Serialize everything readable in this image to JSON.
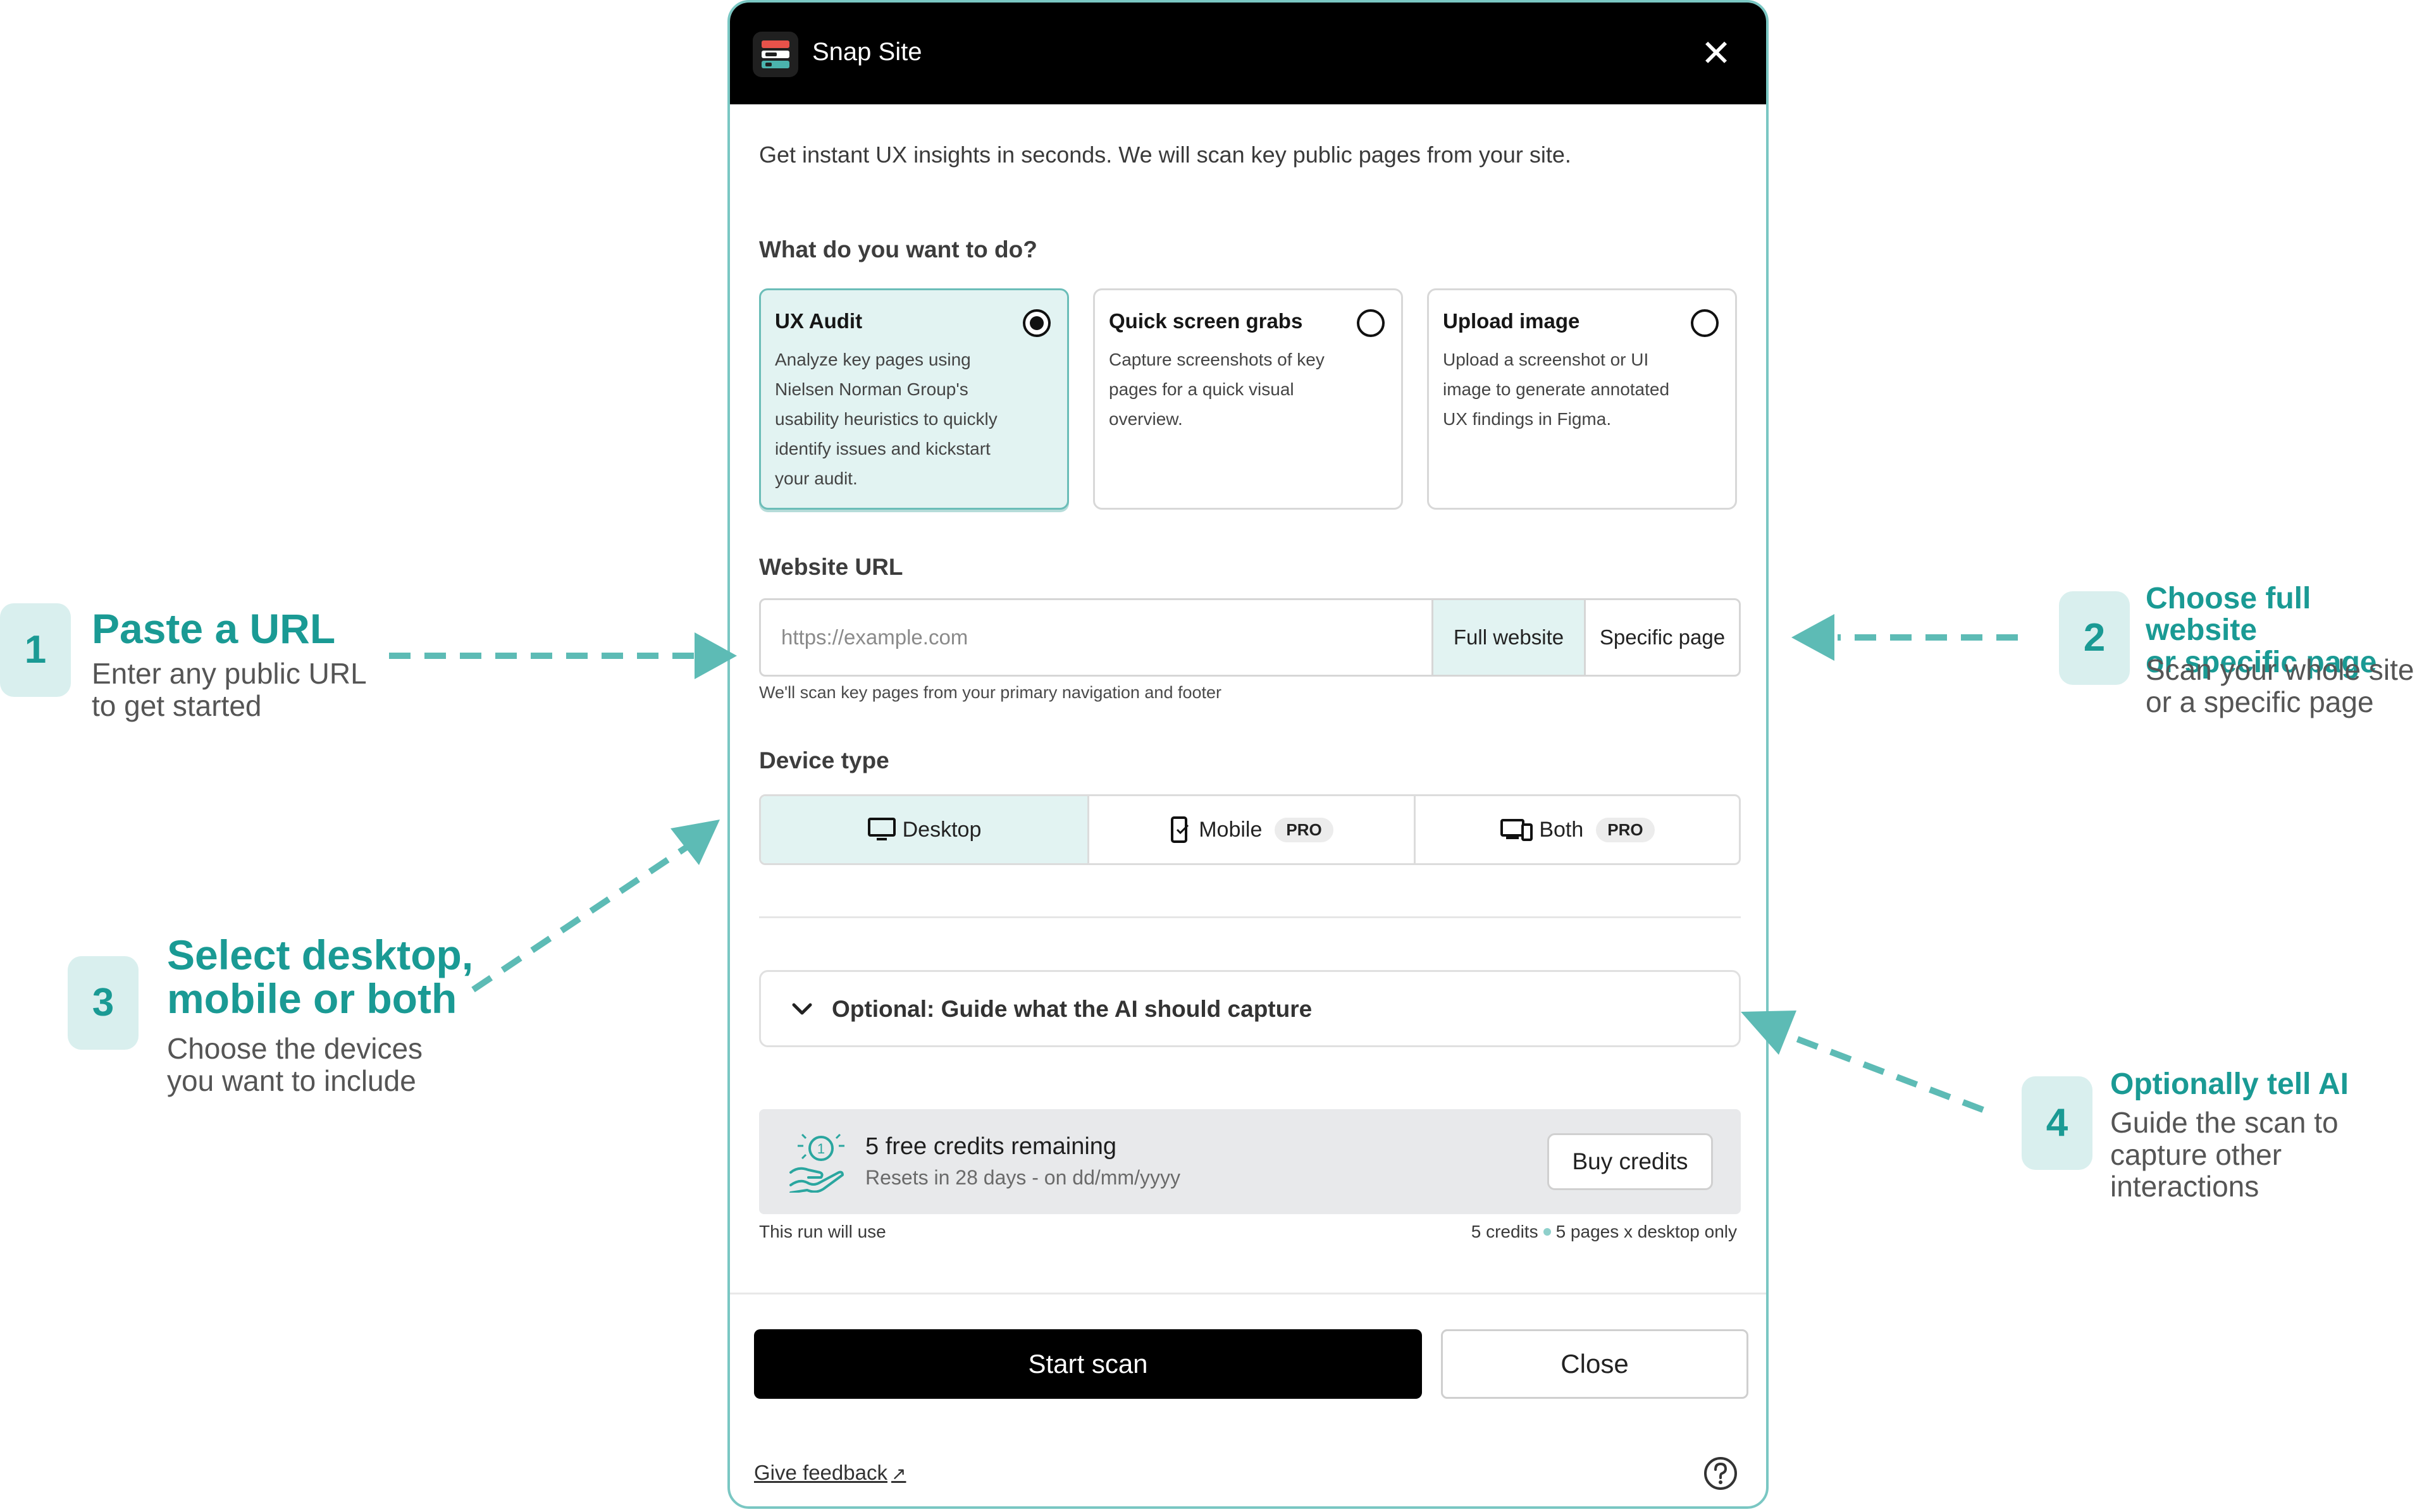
{
  "dialog": {
    "title": "Snap Site",
    "intro": "Get instant UX insights in seconds. We will scan key public pages from your site.",
    "task_label": "What do you want to do?",
    "options": [
      {
        "title": "UX Audit",
        "description": "Analyze key pages using Nielsen Norman Group's usability heuristics to quickly identify issues and kickstart your audit.",
        "selected": true
      },
      {
        "title": "Quick screen grabs",
        "description": "Capture screenshots of key pages for a quick visual overview.",
        "selected": false
      },
      {
        "title": "Upload image",
        "description": "Upload a screenshot or UI image to generate annotated UX findings in Figma.",
        "selected": false
      }
    ],
    "url_label": "Website URL",
    "url_placeholder": "https://example.com",
    "url_value": "",
    "scope_full": "Full website",
    "scope_specific": "Specific page",
    "url_hint": "We'll scan key pages from your primary navigation and footer",
    "device_label": "Device type",
    "devices": [
      {
        "label": "Desktop",
        "badge": "",
        "selected": true
      },
      {
        "label": "Mobile",
        "badge": "PRO",
        "selected": false
      },
      {
        "label": "Both",
        "badge": "PRO",
        "selected": false
      }
    ],
    "guide_label": "Optional: Guide what the AI should capture",
    "credits_title": "5 free credits remaining",
    "credits_sub": "Resets in 28 days - on dd/mm/yyyy",
    "buy_label": "Buy credits",
    "run_left": "This run will use",
    "run_credits": "5 credits",
    "run_detail": "5 pages x desktop only",
    "start_label": "Start scan",
    "close_label": "Close",
    "feedback_label": "Give feedback",
    "feedback_arrow": "↗"
  },
  "callouts": [
    {
      "number": "1",
      "title_lines": [
        "Paste a URL"
      ],
      "sub_lines": [
        "Enter any public URL",
        "to get started"
      ]
    },
    {
      "number": "2",
      "title_lines": [
        "Choose full website",
        "or specific page"
      ],
      "sub_lines": [
        "Scan your whole site",
        "or a specific page"
      ]
    },
    {
      "number": "3",
      "title_lines": [
        "Select desktop,",
        "mobile or both"
      ],
      "sub_lines": [
        "Choose the devices",
        "you want to include"
      ]
    },
    {
      "number": "4",
      "title_lines": [
        "Optionally tell AI"
      ],
      "sub_lines": [
        "Guide the scan to",
        "capture other",
        "interactions"
      ]
    }
  ],
  "colors": {
    "accent": "#1a9a94",
    "accent_light": "#e2f3f2",
    "dialog_border": "#7ac7c3",
    "arrow": "#5dbbb5"
  }
}
